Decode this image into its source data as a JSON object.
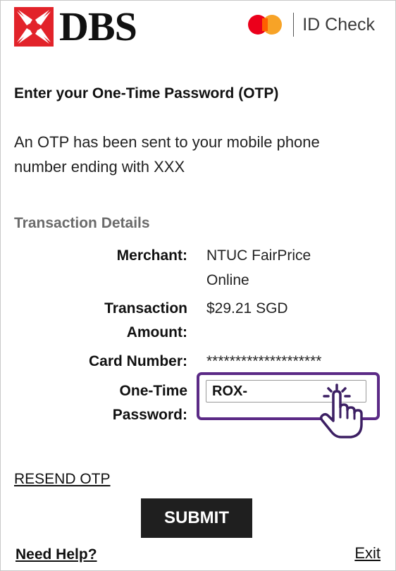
{
  "header": {
    "bank_name": "DBS",
    "scheme_label": "ID Check",
    "brand_color": "#e2232a",
    "mastercard_colors": [
      "#eb001b",
      "#f79e1b"
    ]
  },
  "heading": "Enter your One-Time Password (OTP)",
  "description": "An OTP has been sent to your mobile phone number ending with  XXX",
  "transaction": {
    "section_title": "Transaction Details",
    "merchant_label": "Merchant:",
    "merchant_value_line1": "NTUC FairPrice",
    "merchant_value_line2": "Online",
    "amount_label_line1": "Transaction",
    "amount_label_line2": "Amount:",
    "amount_value": "$29.21 SGD",
    "card_label": "Card Number:",
    "card_value": "********************",
    "otp_label_line1": "One-Time",
    "otp_label_line2": "Password:",
    "otp_value": "ROX-",
    "highlight_color": "#5b2a86",
    "pointer_icon": "hand-pointer-click-icon"
  },
  "actions": {
    "resend_label": "RESEND OTP",
    "submit_label": "SUBMIT",
    "help_label": "Need Help?",
    "exit_label": "Exit"
  }
}
